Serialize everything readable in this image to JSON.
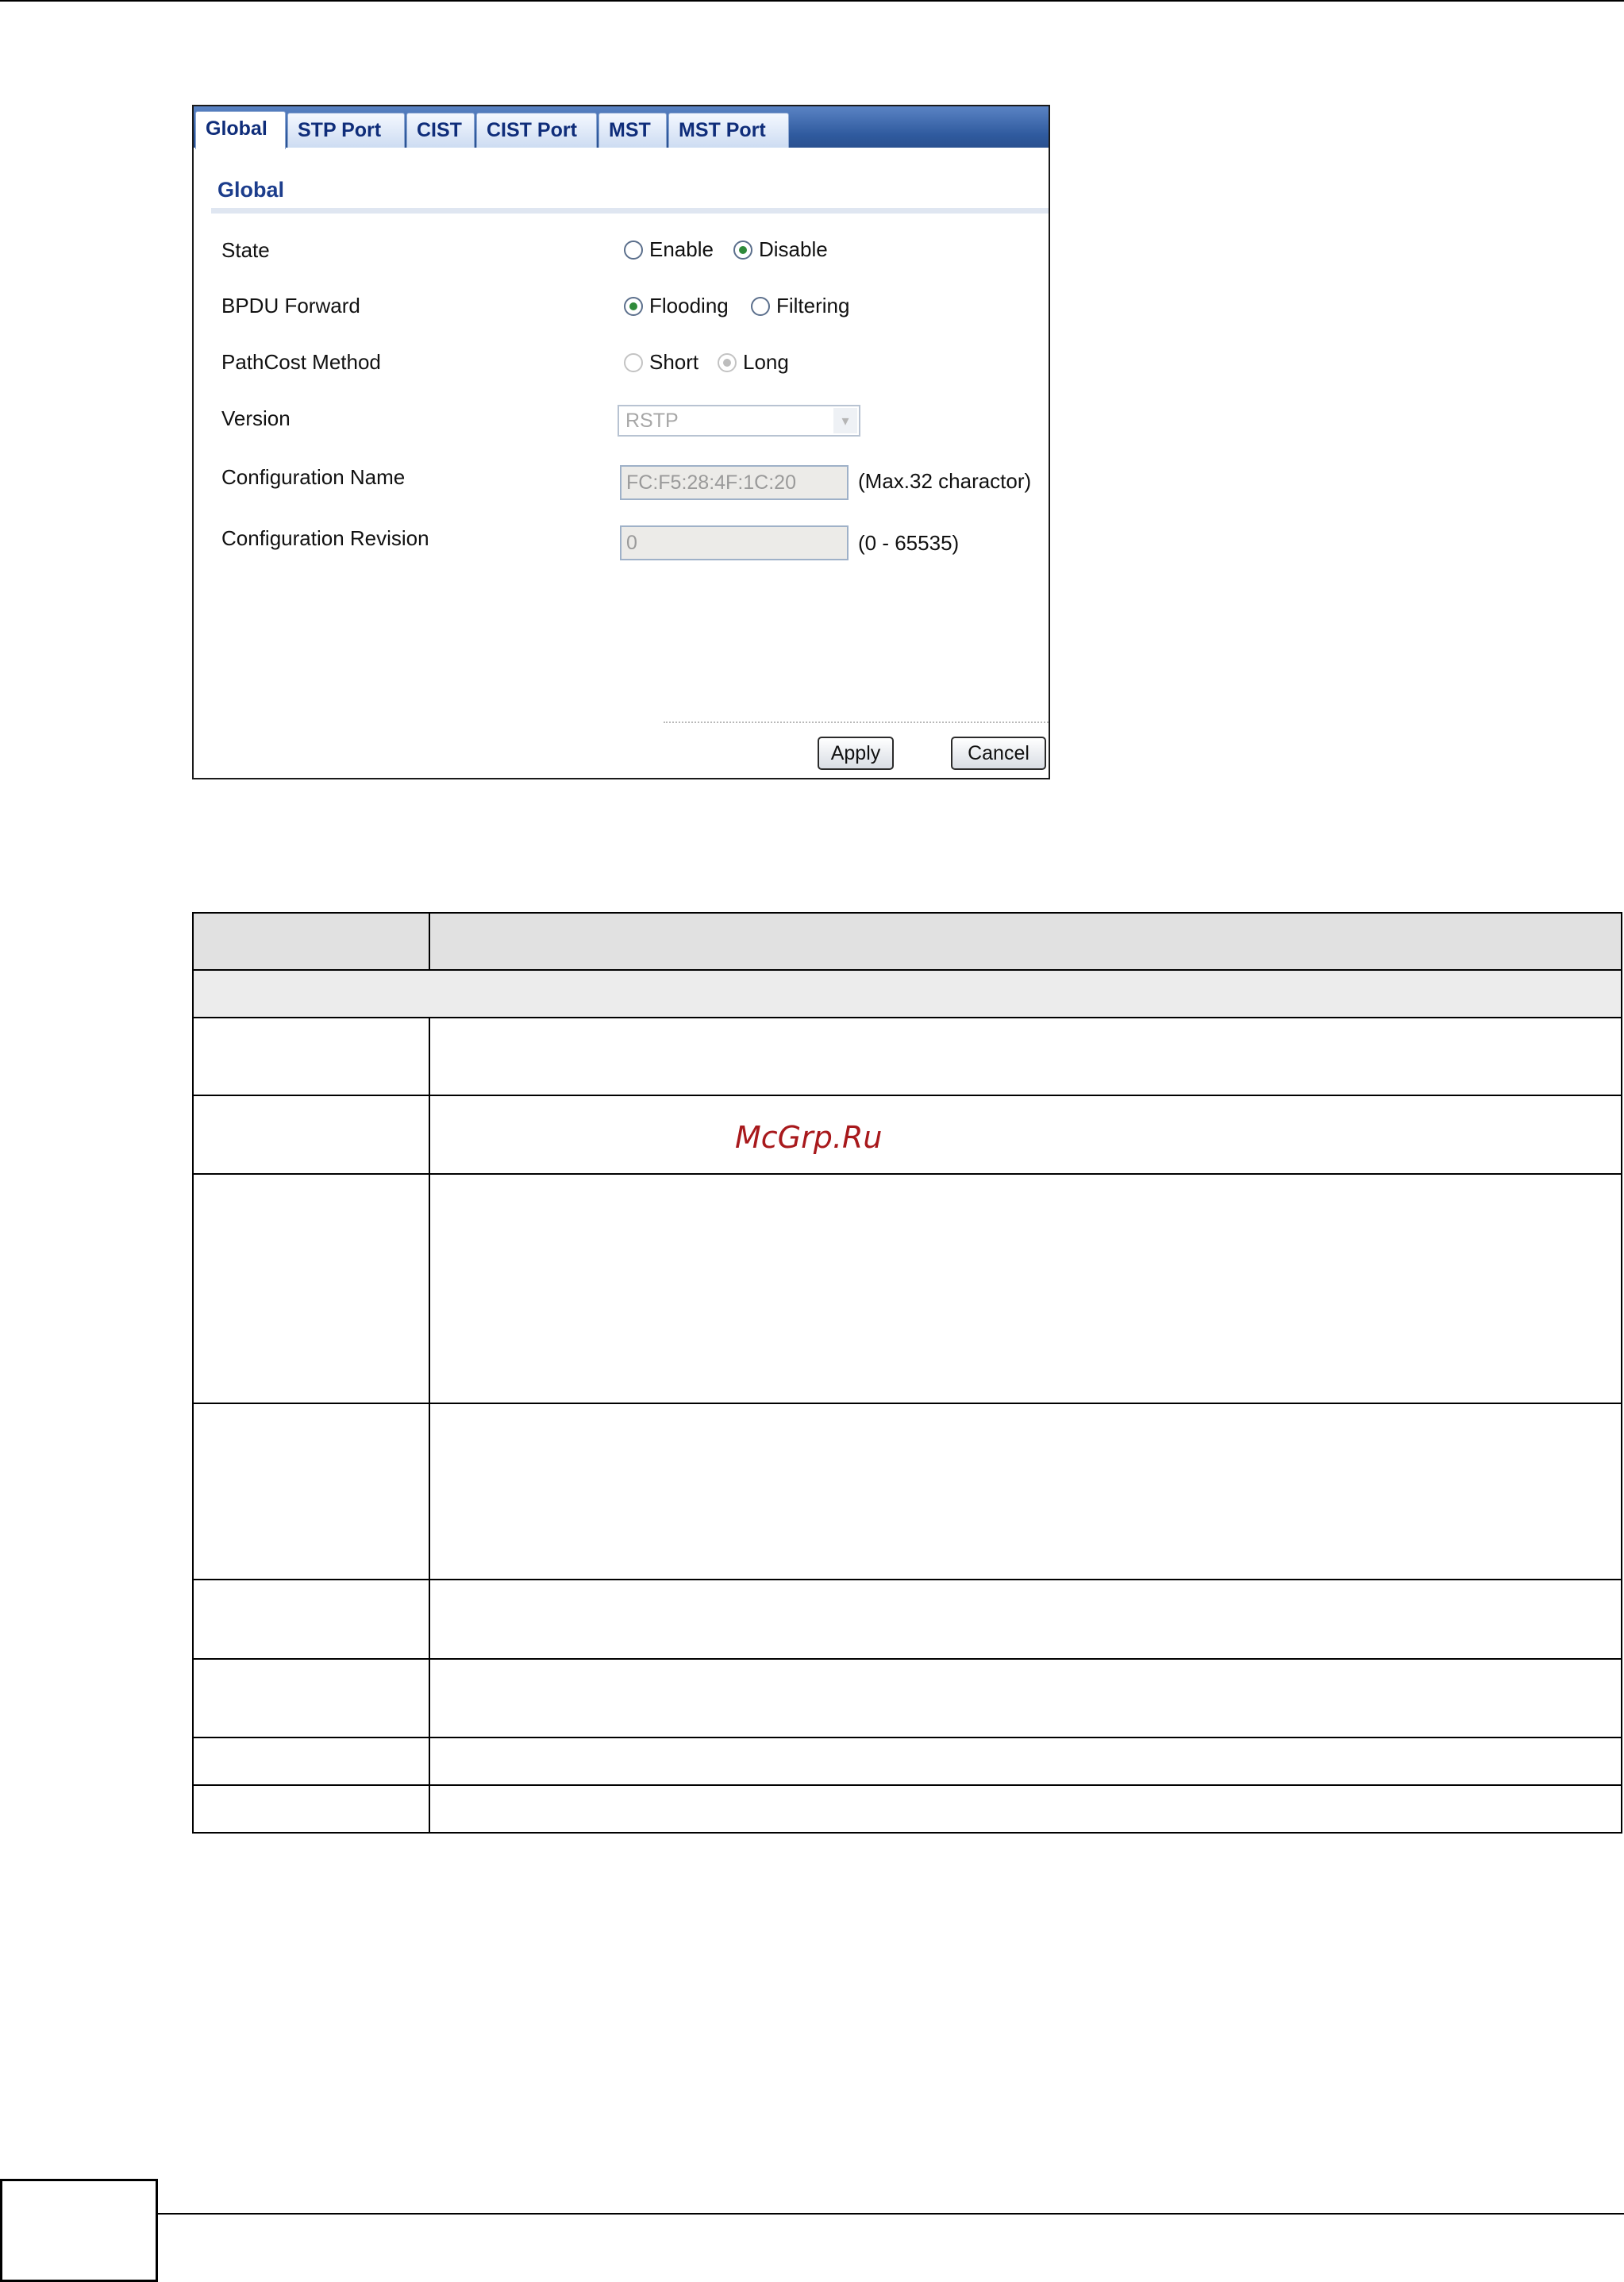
{
  "tabs": [
    "Global",
    "STP Port",
    "CIST",
    "CIST Port",
    "MST",
    "MST Port"
  ],
  "section_title": "Global",
  "fields": {
    "state": {
      "label": "State",
      "options": [
        "Enable",
        "Disable"
      ],
      "selected": "Disable"
    },
    "bpdu_forward": {
      "label": "BPDU Forward",
      "options": [
        "Flooding",
        "Filtering"
      ],
      "selected": "Flooding"
    },
    "pathcost_method": {
      "label": "PathCost Method",
      "options": [
        "Short",
        "Long"
      ],
      "selected": "Long",
      "disabled": true
    },
    "version": {
      "label": "Version",
      "value": "RSTP",
      "disabled": true
    },
    "config_name": {
      "label": "Configuration Name",
      "value": "FC:F5:28:4F:1C:20",
      "hint": "(Max.32 charactor)"
    },
    "config_revision": {
      "label": "Configuration Revision",
      "value": "0",
      "hint": "(0 - 65535)"
    }
  },
  "buttons": {
    "apply": "Apply",
    "cancel": "Cancel"
  },
  "watermark": "McGrp.Ru"
}
